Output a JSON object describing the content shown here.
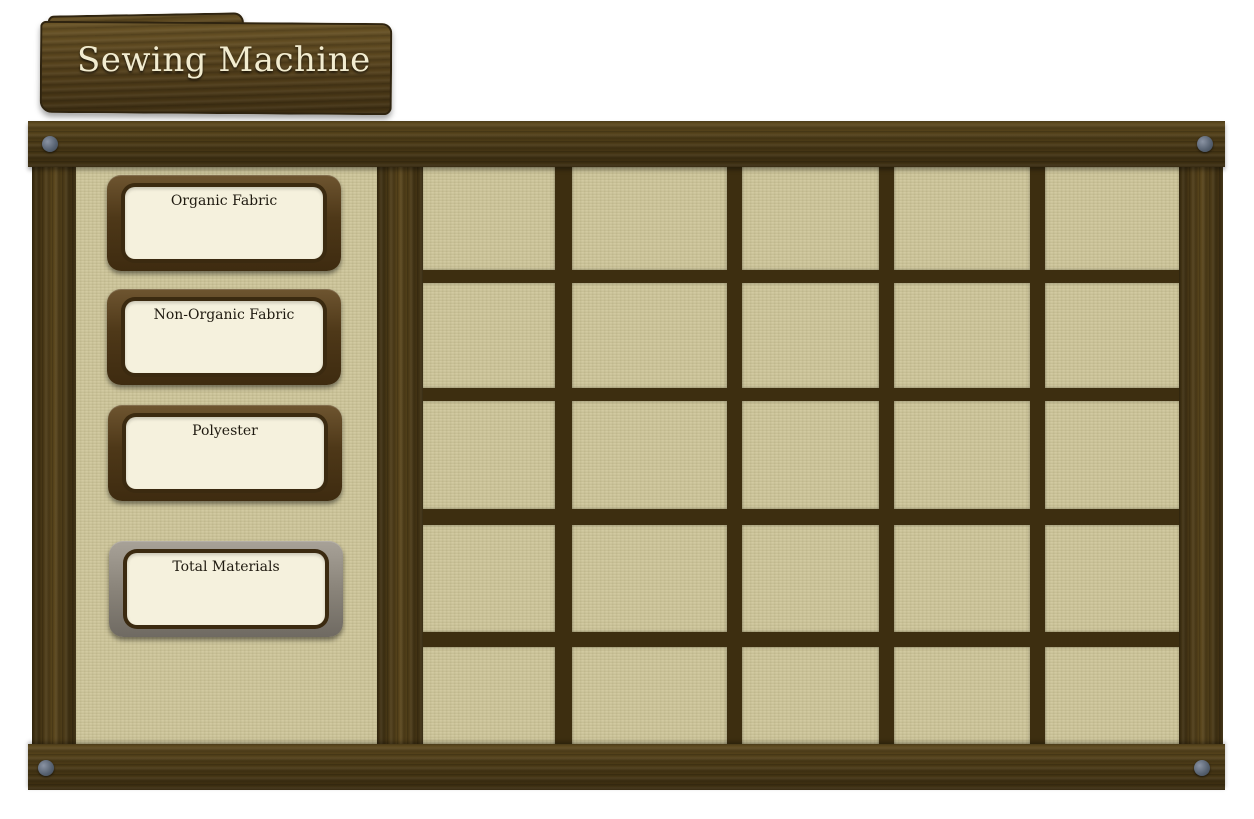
{
  "title": "Sewing Machine",
  "materials": {
    "organic": "Organic Fabric",
    "non_organic": "Non-Organic Fabric",
    "polyester": "Polyester",
    "total": "Total Materials"
  },
  "grid": {
    "rows": 5,
    "columns": 5
  },
  "colors": {
    "wood": "#4b3a16",
    "parchment": "#cfc79c",
    "title_text": "#f2ecd0",
    "slot_fill": "#f5f1dd",
    "bolt": "#55606f"
  }
}
